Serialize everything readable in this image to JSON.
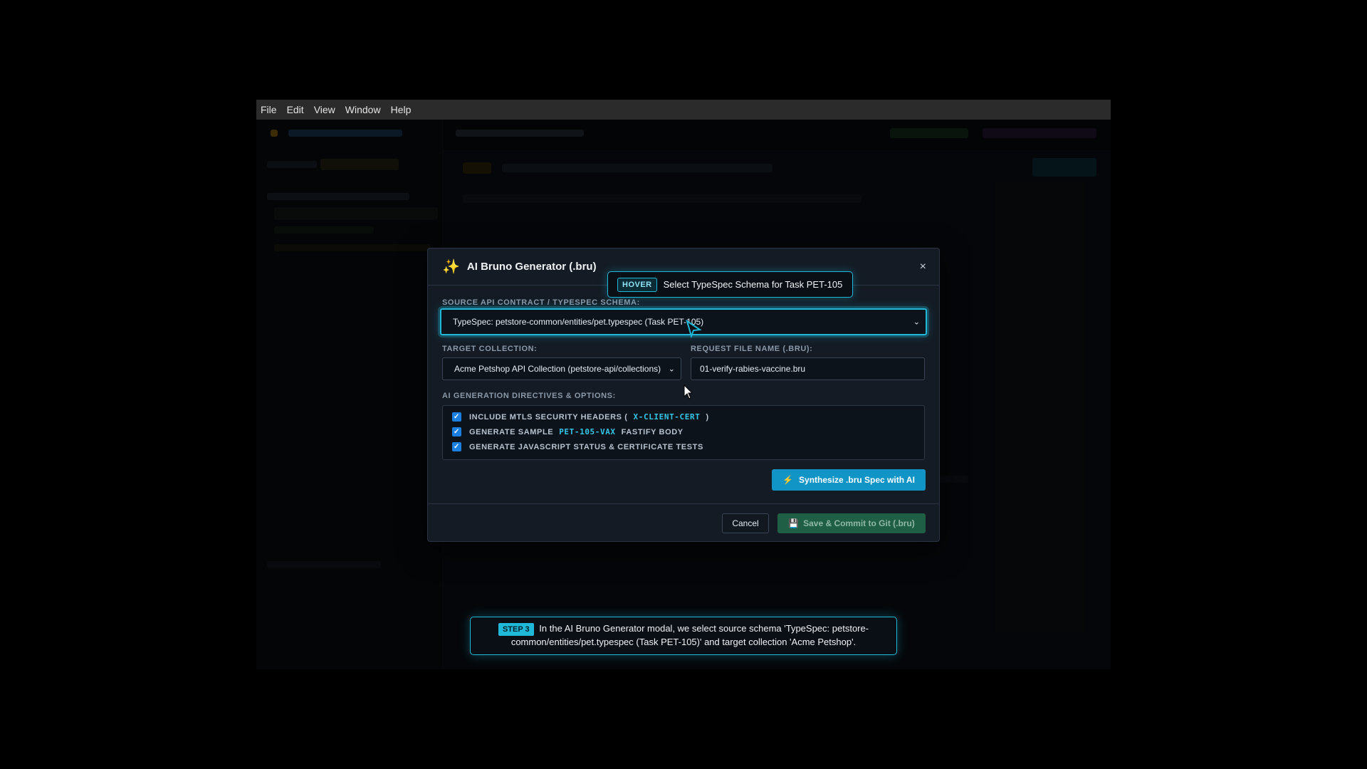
{
  "menubar": [
    "File",
    "Edit",
    "View",
    "Window",
    "Help"
  ],
  "modal": {
    "title": "AI Bruno Generator (.bru)",
    "close": "×",
    "source_label": "SOURCE API CONTRACT / TYPESPEC SCHEMA:",
    "source_value": "TypeSpec: petstore-common/entities/pet.typespec (Task PET-105)",
    "target_label": "TARGET COLLECTION:",
    "target_value": "Acme Petshop API Collection (petstore-api/collections)",
    "filename_label": "REQUEST FILE NAME (.BRU):",
    "filename_value": "01-verify-rabies-vaccine.bru",
    "directives_label": "AI GENERATION DIRECTIVES & OPTIONS:",
    "options": [
      {
        "pre": "INCLUDE MTLS SECURITY HEADERS (",
        "code": "X-CLIENT-CERT",
        "post": ")",
        "checked": true
      },
      {
        "pre": "GENERATE SAMPLE",
        "code": "PET-105-VAX",
        "post": "FASTIFY BODY",
        "checked": true
      },
      {
        "pre": "GENERATE JAVASCRIPT STATUS & CERTIFICATE TESTS",
        "code": "",
        "post": "",
        "checked": true
      }
    ],
    "synth_button": "Synthesize .bru Spec with AI",
    "cancel_button": "Cancel",
    "save_button": "Save & Commit to Git (.bru)"
  },
  "hover": {
    "tag": "HOVER",
    "text": "Select TypeSpec Schema for Task PET-105"
  },
  "step": {
    "tag": "STEP 3",
    "text": "In the AI Bruno Generator modal, we select source schema 'TypeSpec: petstore-common/entities/pet.typespec (Task PET-105)' and target collection 'Acme Petshop'."
  },
  "colors": {
    "accent": "#1fb8d8",
    "primary_button": "#1194c6",
    "save_button": "#1f5f45"
  }
}
